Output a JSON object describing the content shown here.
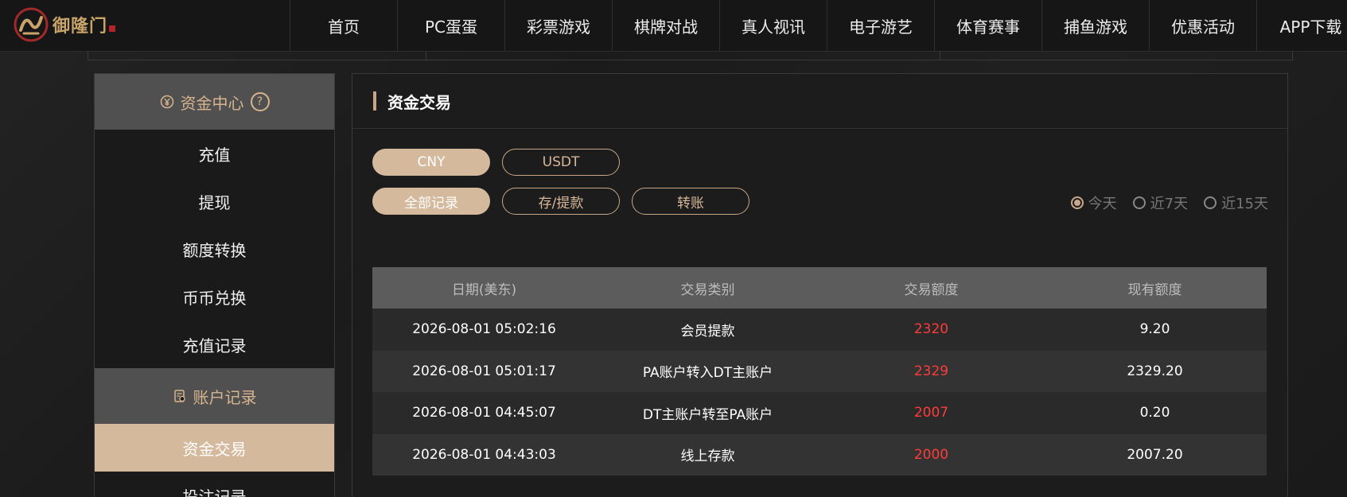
{
  "logo": {
    "text": "御隆门"
  },
  "nav": {
    "items": [
      "首页",
      "PC蛋蛋",
      "彩票游戏",
      "棋牌对战",
      "真人视讯",
      "电子游艺",
      "体育赛事",
      "捕鱼游戏",
      "优惠活动",
      "APP下载"
    ]
  },
  "sidebar": {
    "section1": {
      "title": "资金中心",
      "help": "?"
    },
    "items1": [
      "充值",
      "提现",
      "额度转换",
      "币币兑换",
      "充值记录"
    ],
    "section2": {
      "title": "账户记录"
    },
    "active_item": "资金交易",
    "next_item": "投注记录"
  },
  "main": {
    "title": "资金交易",
    "currency_tabs": [
      "CNY",
      "USDT"
    ],
    "type_tabs": [
      "全部记录",
      "存/提款",
      "转账"
    ],
    "range_options": [
      "今天",
      "近7天",
      "近15天"
    ],
    "table": {
      "headers": [
        "日期(美东)",
        "交易类别",
        "交易额度",
        "现有额度"
      ],
      "rows": [
        [
          "2026-08-01 05:02:16",
          "会员提款",
          "2320",
          "9.20"
        ],
        [
          "2026-08-01 05:01:17",
          "PA账户转入DT主账户",
          "2329",
          "2329.20"
        ],
        [
          "2026-08-01 04:45:07",
          "DT主账户转至PA账户",
          "2007",
          "0.20"
        ],
        [
          "2026-08-01 04:43:03",
          "线上存款",
          "2000",
          "2007.20"
        ]
      ]
    }
  },
  "colors": {
    "accent": "#d4b99d",
    "amount": "#ff3b3b",
    "background": "#1e1e1e"
  }
}
